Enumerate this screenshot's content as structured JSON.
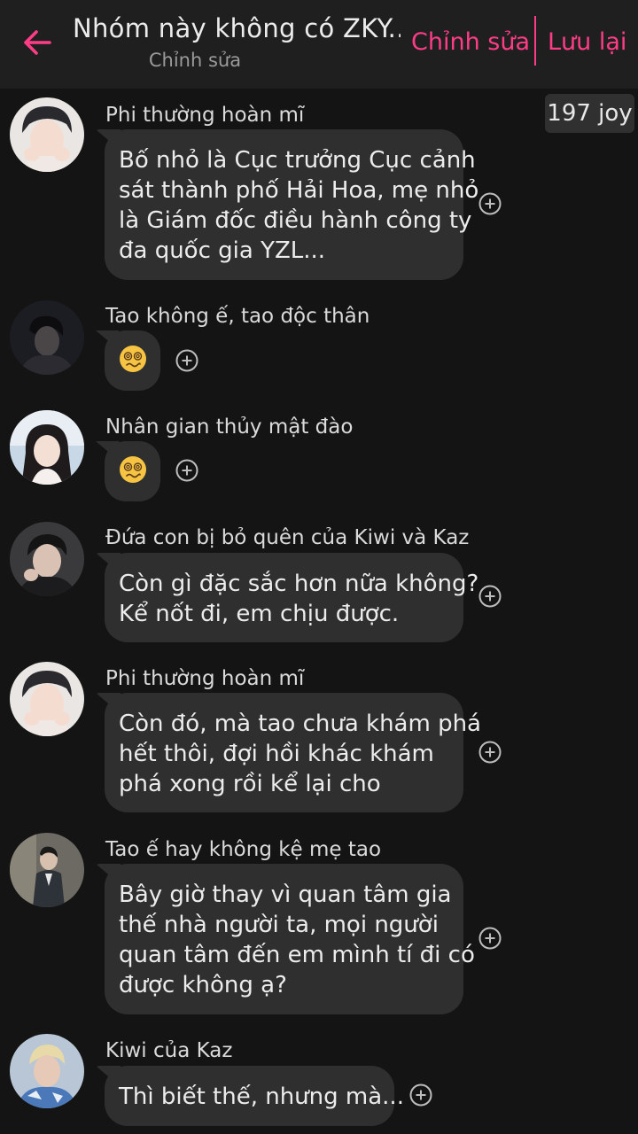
{
  "header": {
    "title": "Nhóm này không có ZKY...",
    "subtitle": "Chỉnh sửa",
    "edit_label": "Chỉnh sửa",
    "save_label": "Lưu lại",
    "accent_color": "#ff3d86"
  },
  "joy_badge": "197 joy",
  "messages": [
    {
      "sender": "Phi thường hoàn mĩ",
      "lines": [
        "Bố nhỏ là Cục trưởng Cục cảnh",
        "sát thành phố Hải Hoa, mẹ nhỏ",
        "là Giám đốc điều hành công ty",
        "đa quốc gia YZL..."
      ]
    },
    {
      "sender": "Tao không ế, tao độc thân",
      "emoji": "dizzy-face-emoji"
    },
    {
      "sender": "Nhân gian thủy mật đào",
      "emoji": "dizzy-face-emoji"
    },
    {
      "sender": "Đứa con bị bỏ quên của Kiwi và Kaz",
      "lines": [
        "Còn gì đặc sắc hơn nữa không?",
        "Kể nốt đi, em chịu được."
      ]
    },
    {
      "sender": "Phi thường hoàn mĩ",
      "lines": [
        "Còn đó, mà tao chưa khám phá",
        "hết thôi, đợi hồi khác khám",
        "phá xong rồi kể lại cho"
      ]
    },
    {
      "sender": "Tao ế hay không kệ mẹ tao",
      "lines": [
        "Bây giờ thay vì quan tâm gia",
        "thế nhà người ta, mọi người",
        "quan tâm đến em mình tí đi có",
        "được không ạ?"
      ]
    },
    {
      "sender": "Kiwi của Kaz",
      "lines": [
        "Thì biết thế, nhưng mà..."
      ]
    }
  ]
}
